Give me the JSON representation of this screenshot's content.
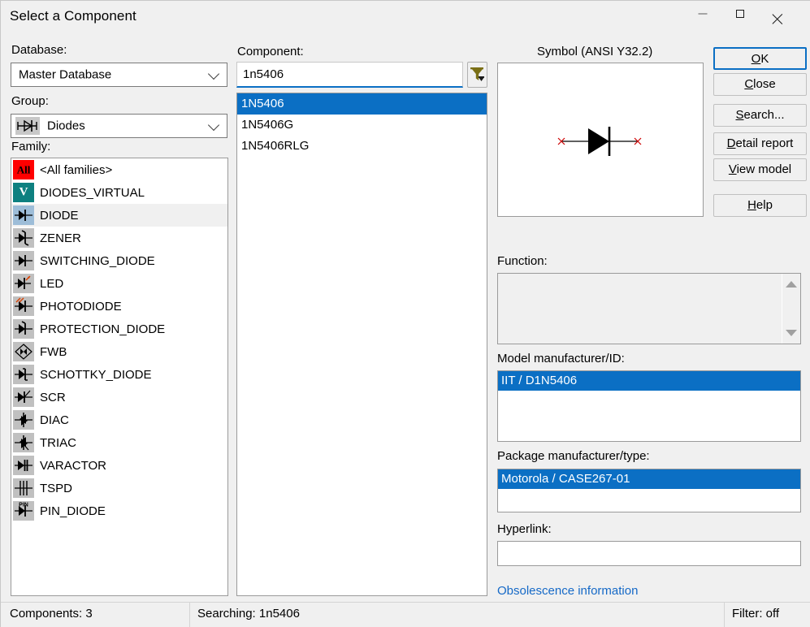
{
  "window": {
    "title": "Select a Component",
    "minimize_label": "Minimize",
    "maximize_label": "Maximize",
    "close_label": "Close"
  },
  "colors": {
    "accent": "#0b6fc4",
    "selection": "#0b6fc4",
    "link": "#1569c7",
    "dialog_bg": "#f0f0f0",
    "all_families_icon": "#ff0000",
    "virtual_icon": "#0e8080",
    "icon_bg": "#c0c0c0",
    "selected_icon_bg": "#9dbdd8"
  },
  "database": {
    "label": "Database:",
    "value": "Master Database"
  },
  "group": {
    "label": "Group:",
    "value": "Diodes"
  },
  "family": {
    "label": "Family:",
    "items": [
      {
        "label": "<All families>",
        "icon": "all-families-icon",
        "icon_text": "All",
        "icon_style": "red",
        "selected": false
      },
      {
        "label": "DIODES_VIRTUAL",
        "icon": "virtual-diode-icon",
        "icon_text": "V",
        "icon_style": "teal",
        "selected": false
      },
      {
        "label": "DIODE",
        "icon": "diode-icon",
        "icon_text": "",
        "icon_style": "gray",
        "selected": true
      },
      {
        "label": "ZENER",
        "icon": "zener-diode-icon",
        "icon_text": "",
        "icon_style": "gray",
        "selected": false
      },
      {
        "label": "SWITCHING_DIODE",
        "icon": "switching-diode-icon",
        "icon_text": "",
        "icon_style": "gray",
        "selected": false
      },
      {
        "label": "LED",
        "icon": "led-icon",
        "icon_text": "",
        "icon_style": "gray",
        "selected": false
      },
      {
        "label": "PHOTODIODE",
        "icon": "photodiode-icon",
        "icon_text": "",
        "icon_style": "gray",
        "selected": false
      },
      {
        "label": "PROTECTION_DIODE",
        "icon": "protection-diode-icon",
        "icon_text": "",
        "icon_style": "gray",
        "selected": false
      },
      {
        "label": "FWB",
        "icon": "full-wave-bridge-icon",
        "icon_text": "",
        "icon_style": "gray",
        "selected": false
      },
      {
        "label": "SCHOTTKY_DIODE",
        "icon": "schottky-diode-icon",
        "icon_text": "",
        "icon_style": "gray",
        "selected": false
      },
      {
        "label": "SCR",
        "icon": "scr-icon",
        "icon_text": "",
        "icon_style": "gray",
        "selected": false
      },
      {
        "label": "DIAC",
        "icon": "diac-icon",
        "icon_text": "",
        "icon_style": "gray",
        "selected": false
      },
      {
        "label": "TRIAC",
        "icon": "triac-icon",
        "icon_text": "",
        "icon_style": "gray",
        "selected": false
      },
      {
        "label": "VARACTOR",
        "icon": "varactor-icon",
        "icon_text": "",
        "icon_style": "gray",
        "selected": false
      },
      {
        "label": "TSPD",
        "icon": "tspd-icon",
        "icon_text": "",
        "icon_style": "gray",
        "selected": false
      },
      {
        "label": "PIN_DIODE",
        "icon": "pin-diode-icon",
        "icon_text": "PIN",
        "icon_style": "gray",
        "selected": false
      }
    ]
  },
  "component": {
    "label": "Component:",
    "search_value": "1n5406",
    "search_placeholder": "",
    "filter_icon": "filter-funnel-icon",
    "items": [
      {
        "label": "1N5406",
        "selected": true
      },
      {
        "label": "1N5406G",
        "selected": false
      },
      {
        "label": "1N5406RLG",
        "selected": false
      }
    ]
  },
  "symbol": {
    "label": "Symbol (ANSI Y32.2)",
    "graphic": "diode-symbol"
  },
  "buttons": [
    {
      "name": "ok-button",
      "label": "OK",
      "mnemonic": "O",
      "default": true
    },
    {
      "name": "close-button",
      "label": "Close",
      "mnemonic": "C",
      "default": false
    },
    {
      "name": "search-button",
      "label": "Search...",
      "mnemonic": "S",
      "default": false
    },
    {
      "name": "detail-report-button",
      "label": "Detail report",
      "mnemonic": "D",
      "default": false
    },
    {
      "name": "view-model-button",
      "label": "View model",
      "mnemonic": "V",
      "default": false
    },
    {
      "name": "help-button",
      "label": "Help",
      "mnemonic": "H",
      "default": false
    }
  ],
  "function": {
    "label": "Function:",
    "value": ""
  },
  "model_manufacturer": {
    "label": "Model manufacturer/ID:",
    "items": [
      {
        "label": "IIT / D1N5406",
        "selected": true
      }
    ]
  },
  "package_manufacturer": {
    "label": "Package manufacturer/type:",
    "items": [
      {
        "label": "Motorola / CASE267-01",
        "selected": true
      }
    ]
  },
  "hyperlink": {
    "label": "Hyperlink:",
    "value": "",
    "placeholder": ""
  },
  "obsolescence": {
    "link_text": "Obsolescence information"
  },
  "statusbar": {
    "components": "Components: 3",
    "searching": "Searching: 1n5406",
    "filter": "Filter: off"
  }
}
